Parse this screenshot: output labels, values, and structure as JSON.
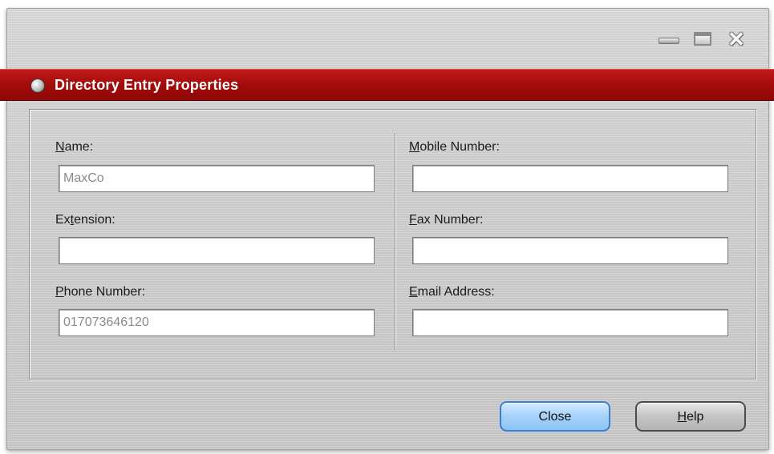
{
  "window": {
    "title": "Directory Entry Properties",
    "controls": {
      "minimize_icon": "minimize-icon",
      "maximize_icon": "maximize-icon",
      "close_icon": "close-icon"
    }
  },
  "colors": {
    "titlebar": "#a50c0c",
    "accent_button": "#8cc4f4"
  },
  "fields": {
    "name": {
      "label_prefix": "",
      "label_access": "N",
      "label_rest": "ame:",
      "value": "MaxCo"
    },
    "extension": {
      "label_prefix": "Ex",
      "label_access": "t",
      "label_rest": "ension:",
      "value": ""
    },
    "phone": {
      "label_prefix": "",
      "label_access": "P",
      "label_rest": "hone Number:",
      "value": "017073646120"
    },
    "mobile": {
      "label_prefix": "",
      "label_access": "M",
      "label_rest": "obile Number:",
      "value": ""
    },
    "fax": {
      "label_prefix": "",
      "label_access": "F",
      "label_rest": "ax Number:",
      "value": ""
    },
    "email": {
      "label_prefix": "",
      "label_access": "E",
      "label_rest": "mail Address:",
      "value": ""
    }
  },
  "buttons": {
    "close_label": "Close",
    "help_access": "H",
    "help_rest": "elp"
  }
}
